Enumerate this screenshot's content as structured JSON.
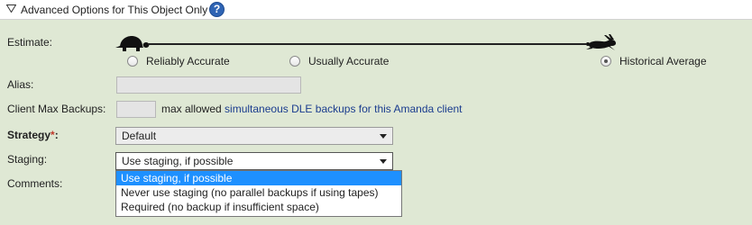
{
  "section": {
    "title": "Advanced Options for This Object Only",
    "help_glyph": "?"
  },
  "estimate": {
    "label": "Estimate:",
    "options": [
      {
        "label": "Reliably Accurate",
        "checked": false
      },
      {
        "label": "Usually Accurate",
        "checked": false
      },
      {
        "label": "Historical Average",
        "checked": true
      }
    ]
  },
  "alias": {
    "label": "Alias:",
    "value": ""
  },
  "client_max_backups": {
    "label": "Client Max Backups:",
    "value": "",
    "suffix_text": "max allowed",
    "link_text": "simultaneous DLE backups for this Amanda client"
  },
  "strategy": {
    "label": "Strategy",
    "required_mark": "*",
    "colon": ":",
    "value": "Default"
  },
  "staging": {
    "label": "Staging:",
    "value": "Use staging, if possible",
    "options": [
      "Use staging, if possible",
      "Never use staging (no parallel backups if using tapes)",
      "Required (no backup if insufficient space)"
    ]
  },
  "comments": {
    "label": "Comments:"
  },
  "colors": {
    "background": "#dfe8d4",
    "accent": "#2f64b4",
    "selected_option": "#1e90ff",
    "link": "#1a3c8e",
    "required": "#c0392b"
  },
  "icons": [
    "chevron-down-icon",
    "help-icon",
    "turtle-icon",
    "rabbit-icon"
  ]
}
